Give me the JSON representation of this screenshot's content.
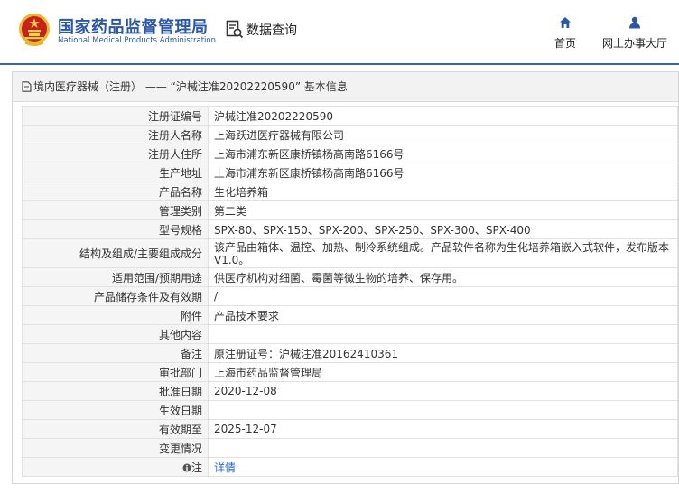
{
  "header": {
    "site_title_cn": "国家药品监督管理局",
    "site_title_en": "National Medical Products Administration",
    "query_label": "数据查询",
    "home_label": "首页",
    "service_hall_label": "网上办事大厅",
    "colors": {
      "brand_blue": "#2a57a8",
      "emblem_red": "#c8201c",
      "emblem_gold": "#e8b92b"
    }
  },
  "panel": {
    "breadcrumb": "境内医疗器械（注册） —— “沪械注准20202220590” 基本信息"
  },
  "table": {
    "rows": [
      {
        "label": "注册证编号",
        "value": "沪械注准20202220590"
      },
      {
        "label": "注册人名称",
        "value": "上海跃进医疗器械有限公司"
      },
      {
        "label": "注册人住所",
        "value": "上海市浦东新区康桥镇杨高南路6166号"
      },
      {
        "label": "生产地址",
        "value": "上海市浦东新区康桥镇杨高南路6166号"
      },
      {
        "label": "产品名称",
        "value": "生化培养箱"
      },
      {
        "label": "管理类别",
        "value": "第二类"
      },
      {
        "label": "型号规格",
        "value": "SPX-80、SPX-150、SPX-200、SPX-250、SPX-300、SPX-400"
      },
      {
        "label": "结构及组成/主要组成成分",
        "value": "该产品由箱体、温控、加热、制冷系统组成。产品软件名称为生化培养箱嵌入式软件，发布版本V1.0。"
      },
      {
        "label": "适用范围/预期用途",
        "value": "供医疗机构对细菌、霉菌等微生物的培养、保存用。"
      },
      {
        "label": "产品储存条件及有效期",
        "value": "/"
      },
      {
        "label": "附件",
        "value": "产品技术要求"
      },
      {
        "label": "其他内容",
        "value": ""
      },
      {
        "label": "备注",
        "value": "原注册证号：沪械注准20162410361"
      },
      {
        "label": "审批部门",
        "value": "上海市药品监督管理局"
      },
      {
        "label": "批准日期",
        "value": "2020-12-08"
      },
      {
        "label": "生效日期",
        "value": ""
      },
      {
        "label": "有效期至",
        "value": "2025-12-07"
      },
      {
        "label": "变更情况",
        "value": ""
      }
    ],
    "note_label": "注",
    "note_link": "详情"
  }
}
